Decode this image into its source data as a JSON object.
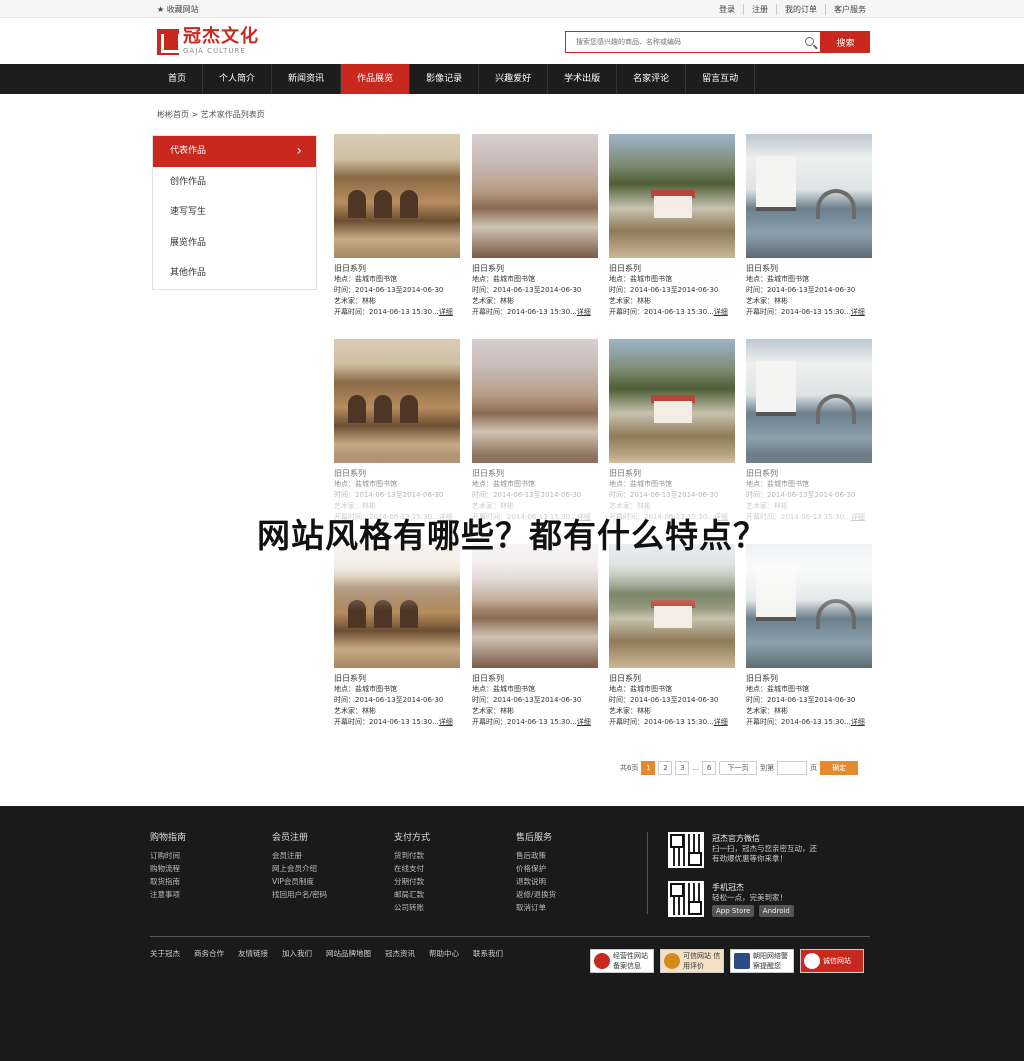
{
  "topbar": {
    "favorite": "★ 收藏网站",
    "links": [
      "登录",
      "注册",
      "我的订单",
      "客户服务"
    ]
  },
  "logo": {
    "cn": "冠杰文化",
    "en": "GAJA CULTURE"
  },
  "search": {
    "placeholder": "搜索您感兴趣的商品、名称或编码",
    "button": "搜索"
  },
  "nav": [
    "首页",
    "个人简介",
    "新闻资讯",
    "作品展览",
    "影像记录",
    "兴趣爱好",
    "学术出版",
    "名家评论",
    "留言互动"
  ],
  "nav_active": "作品展览",
  "breadcrumb": "彬彬首页 > 艺术家作品列表页",
  "sidebar": [
    "代表作品",
    "创作作品",
    "速写写生",
    "展览作品",
    "其他作品"
  ],
  "card": {
    "title": "旧日系列",
    "location": "地点：盐城市图书馆",
    "time": "时间：2014-06-13至2014-06-30",
    "artist": "艺术家：林彬",
    "opening": "开幕时间：2014-06-13 15:30...",
    "detail": "详细"
  },
  "pager": {
    "total": "共6页",
    "pages": [
      "1",
      "2",
      "3",
      "6"
    ],
    "ellipsis": "...",
    "next": "下一页",
    "goto": "到第",
    "page_unit": "页",
    "confirm": "确定"
  },
  "headline": "网站风格有哪些？都有什么特点？",
  "footer": {
    "cols": [
      {
        "title": "购物指南",
        "items": [
          "订购时间",
          "购物流程",
          "取货指南",
          "注意事项"
        ]
      },
      {
        "title": "会员注册",
        "items": [
          "会员注册",
          "网上会员介绍",
          "VIP会员制度",
          "找回用户名/密码"
        ]
      },
      {
        "title": "支付方式",
        "items": [
          "货到付款",
          "在线支付",
          "分期付款",
          "邮局汇款",
          "公司转账"
        ]
      },
      {
        "title": "售后服务",
        "items": [
          "售后政策",
          "价格保护",
          "退款说明",
          "返修/退换货",
          "取消订单"
        ]
      }
    ],
    "wechat": {
      "title": "冠杰官方微信",
      "line1": "扫一扫，冠杰与您亲密互动，还",
      "line2": "有劲爆优惠等你来拿！"
    },
    "mobile": {
      "title": "手机冠杰",
      "line1": "轻松一点，完美到家！",
      "appstore": "App Store",
      "android": "Android"
    },
    "links": [
      "关于冠杰",
      "商务合作",
      "友情链接",
      "加入我们",
      "网站品牌地图",
      "冠杰资讯",
      "帮助中心",
      "联系我们"
    ],
    "badges": [
      "经营性网站 备案信息",
      "可信网站 信用评价",
      "朝阳网络警 察提醒您",
      "诚信网站"
    ]
  }
}
